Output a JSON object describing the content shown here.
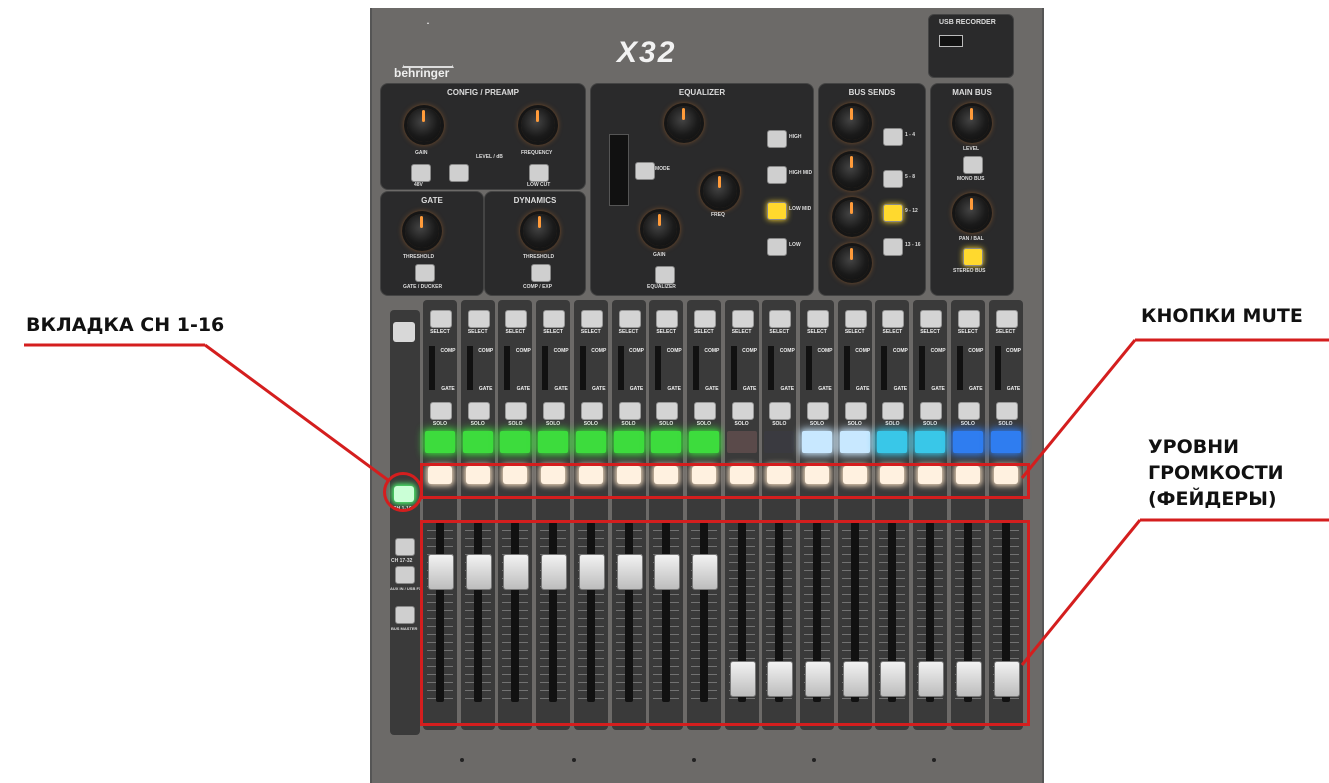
{
  "annotations": {
    "ch_tab_label": "ВКЛАДКА CH 1-16",
    "mute_label": "КНОПКИ MUTE",
    "faders_label_1": "УРОВНИ",
    "faders_label_2": "ГРОМКОСТИ",
    "faders_label_3": "(ФЕЙДЕРЫ)"
  },
  "annotation_color": "#d41e1e",
  "console": {
    "brand": "behringer",
    "model": "X32",
    "usb_recorder": "USB RECORDER",
    "sections": {
      "config": "CONFIG / PREAMP",
      "equalizer": "EQUALIZER",
      "bus_sends": "BUS SENDS",
      "main_bus": "MAIN BUS",
      "gate": "GATE",
      "dynamics": "DYNAMICS"
    },
    "labels": {
      "gain": "GAIN",
      "frequency": "FREQUENCY",
      "low_cut": "LOW CUT",
      "v48": "48V",
      "level_db": "LEVEL / dB",
      "threshold": "THRESHOLD",
      "gate_ducker": "GATE / DUCKER",
      "comp_exp": "COMP / EXP",
      "mode": "MODE",
      "freq": "FREQ",
      "high": "HIGH",
      "high_mid": "HIGH MID",
      "low_mid": "LOW MID",
      "low": "LOW",
      "bus_1_4": "1 - 4",
      "bus_5_8": "5 - 8",
      "bus_9_12": "9 - 12",
      "bus_13_16": "13 - 16",
      "level": "LEVEL",
      "mono_bus": "MONO BUS",
      "pan_bal": "PAN / BAL",
      "stereo_bus": "STEREO BUS",
      "equalizer_btn": "EQUALIZER"
    },
    "strip_labels": {
      "select": "SELECT",
      "solo": "SOLO",
      "comp": "COMP",
      "gate": "GATE"
    },
    "layer_buttons": [
      "CH 1-16",
      "CH 17-32",
      "AUX IN / USB FX RETURNS",
      "BUS MASTER"
    ],
    "channel_lcd_colors": [
      "#3ddc3d",
      "#3ddc3d",
      "#3ddc3d",
      "#3ddc3d",
      "#3ddc3d",
      "#3ddc3d",
      "#3ddc3d",
      "#3ddc3d",
      "#5a4a4a",
      "#3a3a40",
      "#c8e8ff",
      "#c8e8ff",
      "#39c7e8",
      "#39c7e8",
      "#2f7df0",
      "#2f7df0"
    ],
    "fader_levels": [
      0.78,
      0.78,
      0.78,
      0.78,
      0.78,
      0.78,
      0.78,
      0.78,
      0.05,
      0.05,
      0.05,
      0.05,
      0.05,
      0.05,
      0.05,
      0.05
    ]
  }
}
